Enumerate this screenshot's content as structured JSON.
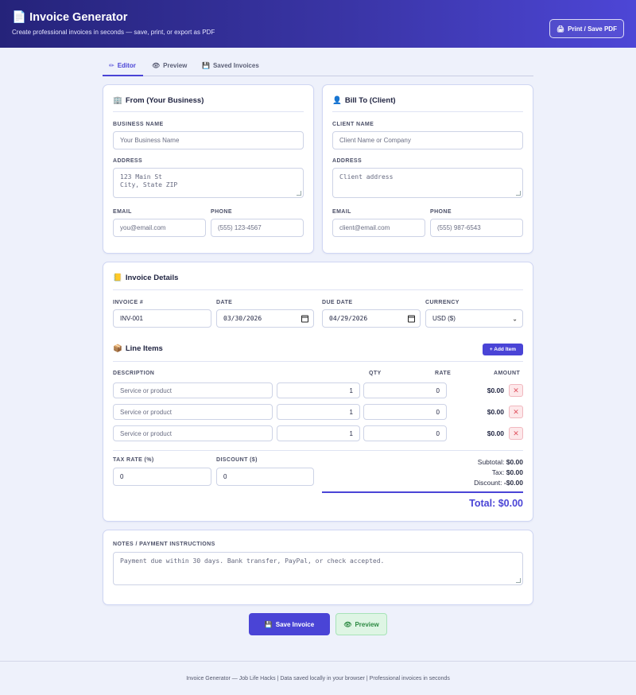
{
  "header": {
    "icon": "document-icon",
    "title": "Invoice Generator",
    "subtitle": "Create professional invoices in seconds — save, print, or export as PDF",
    "print_button": "Print / Save PDF",
    "gradient": [
      "#25237a",
      "#4d46d6"
    ]
  },
  "tabs": [
    {
      "icon": "pencil-icon",
      "label": "Editor",
      "active": true
    },
    {
      "icon": "eye-icon",
      "label": "Preview",
      "active": false
    },
    {
      "icon": "floppy-disk-icon",
      "label": "Saved Invoices",
      "active": false
    }
  ],
  "from": {
    "title": "From (Your Business)",
    "business_name_label": "BUSINESS NAME",
    "business_name_placeholder": "Your Business Name",
    "address_label": "ADDRESS",
    "address_placeholder": "123 Main St\nCity, State ZIP",
    "email_label": "EMAIL",
    "email_placeholder": "you@email.com",
    "phone_label": "PHONE",
    "phone_placeholder": "(555) 123-4567"
  },
  "bill_to": {
    "title": "Bill To (Client)",
    "client_name_label": "CLIENT NAME",
    "client_name_placeholder": "Client Name or Company",
    "address_label": "ADDRESS",
    "address_placeholder": "Client address",
    "email_label": "EMAIL",
    "email_placeholder": "client@email.com",
    "phone_label": "PHONE",
    "phone_placeholder": "(555) 987-6543"
  },
  "details": {
    "title": "Invoice Details",
    "invoice_label": "INVOICE #",
    "invoice_value": "INV-001",
    "date_label": "DATE",
    "date_value": "03/30/2026",
    "due_label": "DUE DATE",
    "due_value": "04/29/2026",
    "currency_label": "CURRENCY",
    "currency_value": "USD ($)"
  },
  "line_items": {
    "title": "Line Items",
    "add_button": "+ Add Item",
    "columns": [
      "DESCRIPTION",
      "QTY",
      "RATE",
      "AMOUNT"
    ],
    "rows": [
      {
        "description_placeholder": "Service or product",
        "qty": "1",
        "rate": "0",
        "amount": "$0.00"
      },
      {
        "description_placeholder": "Service or product",
        "qty": "1",
        "rate": "0",
        "amount": "$0.00"
      },
      {
        "description_placeholder": "Service or product",
        "qty": "1",
        "rate": "0",
        "amount": "$0.00"
      }
    ],
    "delete_glyph": "✕"
  },
  "adjustments": {
    "tax_label": "TAX RATE (%)",
    "tax_value": "0",
    "discount_label": "DISCOUNT ($)",
    "discount_value": "0"
  },
  "totals": {
    "subtotal_label": "Subtotal:",
    "subtotal_value": "$0.00",
    "tax_label": "Tax:",
    "tax_value": "$0.00",
    "discount_label": "Discount:",
    "discount_value": "-$0.00",
    "total_label": "Total:",
    "total_value": "$0.00"
  },
  "notes": {
    "label": "NOTES / PAYMENT INSTRUCTIONS",
    "placeholder": "Payment due within 30 days. Bank transfer, PayPal, or check accepted."
  },
  "actions": {
    "save_button": "Save Invoice",
    "preview_button": "Preview"
  },
  "footer": {
    "text": "Invoice Generator — Job Life Hacks | Data saved locally in your browser | Professional invoices in seconds"
  },
  "colors": {
    "accent": "#4a44d6",
    "danger": "#e0525f",
    "success": "#2d8a43",
    "background": "#eef1fb"
  }
}
